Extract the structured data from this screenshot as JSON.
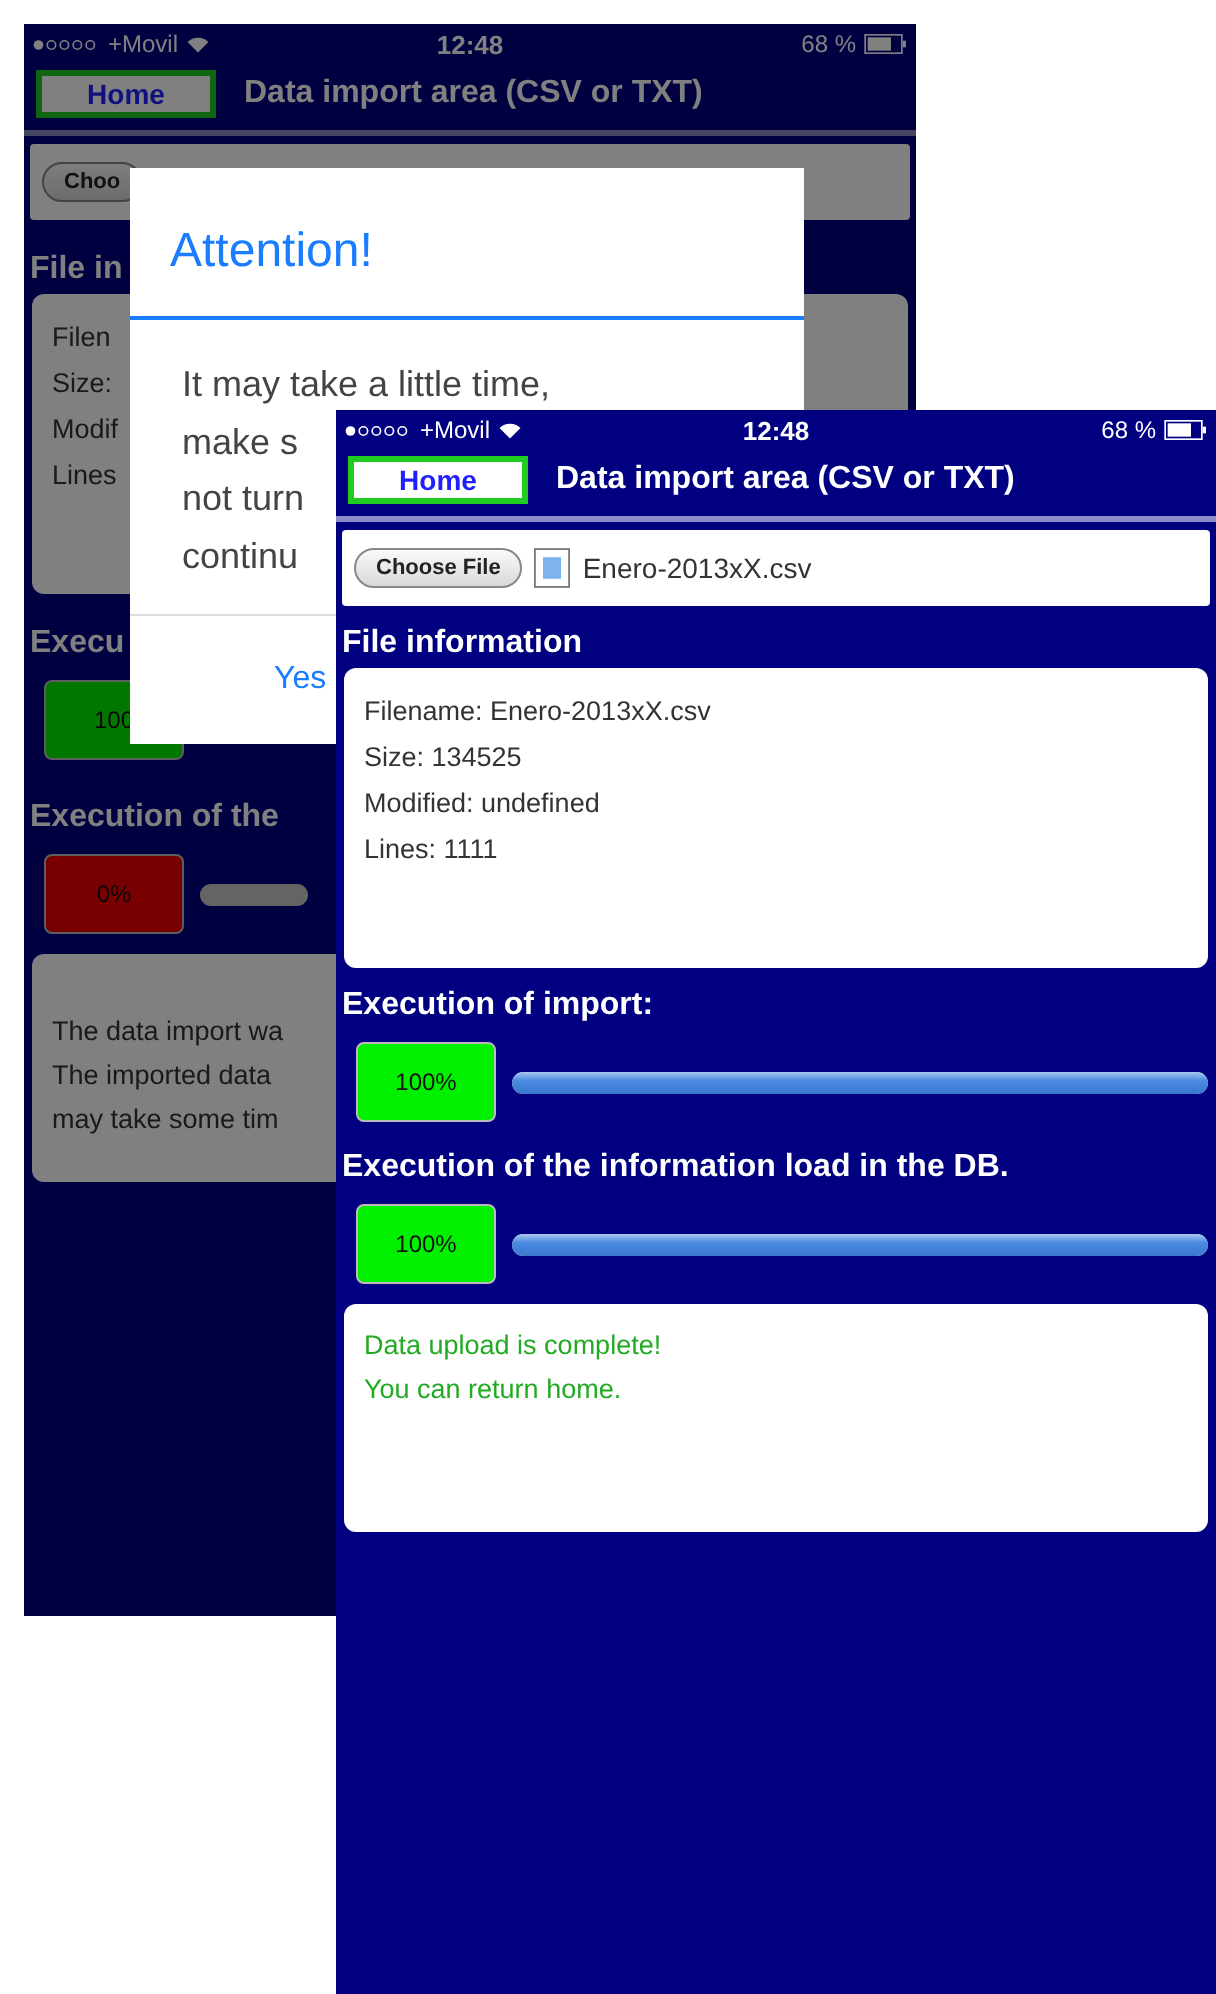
{
  "back_screen": {
    "dimmed": true,
    "status_bar": {
      "carrier": "+Movil",
      "time": "12:48",
      "battery": "68 %"
    },
    "home_button": "Home",
    "title": "Data import area (CSV or TXT)",
    "choose_file_button": "Choo",
    "file_info_heading": "File in",
    "file_info_lines": [
      "Filen",
      "Size:",
      "Modif",
      "Lines"
    ],
    "import_heading": "Execu",
    "import_badge": {
      "text": "100",
      "kind": "done"
    },
    "load_heading": "Execution of the",
    "load_badge": {
      "text": "0%",
      "kind": "failed"
    },
    "load_progress": {
      "level": 0
    },
    "message": {
      "kind": "info",
      "lines": [
        "The data import wa",
        "The imported data",
        "may take some tim"
      ]
    }
  },
  "dialog": {
    "title": "Attention!",
    "lines": [
      "It may take a little time,",
      "make s",
      "not turn",
      "continu"
    ],
    "button": "Yes"
  },
  "front_screen": {
    "status_bar": {
      "carrier": "+Movil",
      "time": "12:48",
      "battery": "68 %"
    },
    "home_button": "Home",
    "title": "Data import area (CSV or TXT)",
    "choose_file_button": "Choose File",
    "file_name": "Enero-2013xX.csv",
    "file_info_heading": "File information",
    "file_info_lines": [
      "Filename: Enero-2013xX.csv",
      "Size: 134525",
      "Modified: undefined",
      "Lines: 1111"
    ],
    "import_heading": "Execution of import:",
    "import_badge": {
      "text": "100%",
      "kind": "done"
    },
    "import_progress": {
      "level": 1
    },
    "load_heading": "Execution of the information load in the DB.",
    "load_badge": {
      "text": "100%",
      "kind": "done"
    },
    "load_progress": {
      "level": 1
    },
    "message": {
      "kind": "success",
      "lines": [
        "Data upload is complete!",
        "You can return home."
      ]
    }
  }
}
